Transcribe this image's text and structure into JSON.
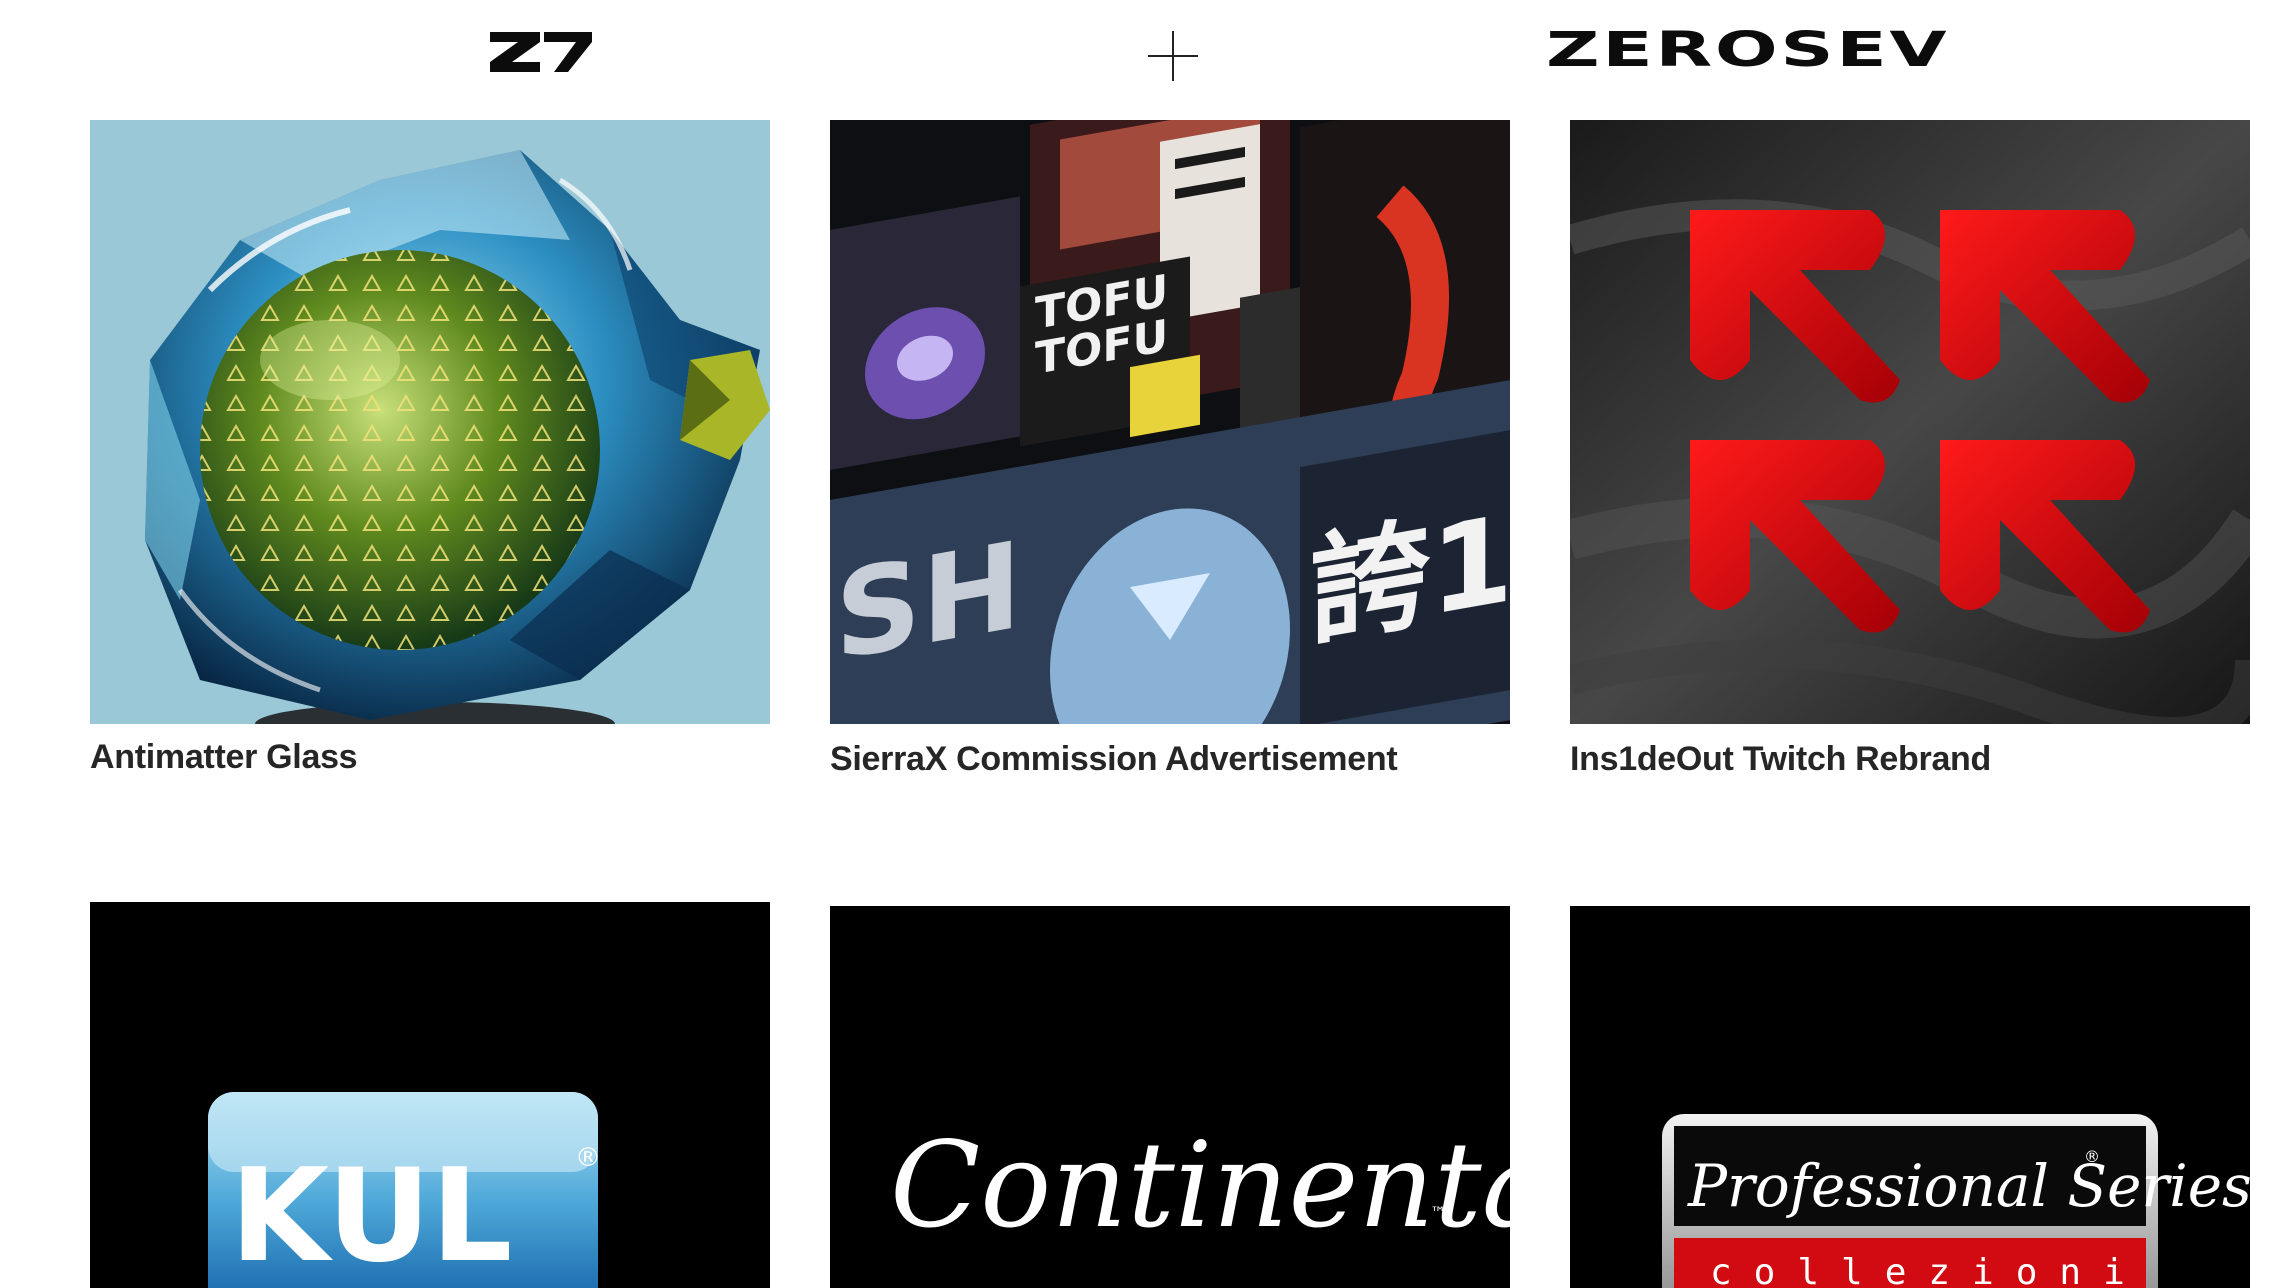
{
  "header": {
    "brand_left": "Z7",
    "separator": "+",
    "brand_right": "ZEROSEV"
  },
  "projects": [
    {
      "title": "Antimatter Glass",
      "thumbnail": "abstract glass sphere render"
    },
    {
      "title": "SierraX Commission Advertisement",
      "thumbnail": "collage of gaming poster panels"
    },
    {
      "title": "Ins1deOut Twitch Rebrand",
      "thumbnail": "four red arrows on dark fabric"
    },
    {
      "title": "",
      "thumbnail": "KUL logo on black",
      "logo_text": "KUL",
      "logo_mark": "®"
    },
    {
      "title": "",
      "thumbnail": "Continental script logo on black",
      "logo_text": "Continental",
      "logo_mark": "™"
    },
    {
      "title": "",
      "thumbnail": "Professional Series collezioni logo on black",
      "logo_text": "Professional Series",
      "logo_subtext": "collezioni",
      "logo_mark": "®"
    }
  ],
  "colors": {
    "background": "#ffffff",
    "caption": "#262626",
    "accent_red": "#d0060a",
    "kul_blue": "#1f7fc0"
  },
  "icons": [
    "plus-icon"
  ]
}
